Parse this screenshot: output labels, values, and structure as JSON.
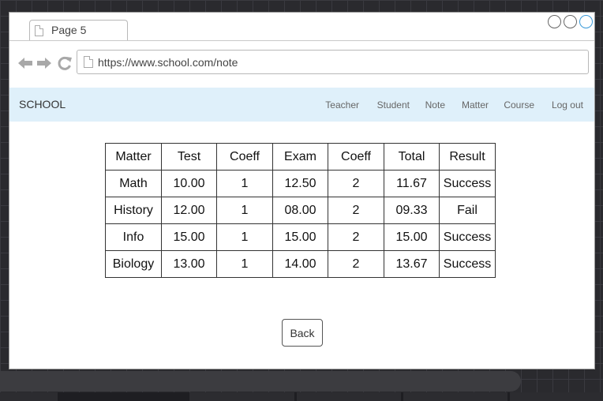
{
  "browser": {
    "tab_title": "Page 5",
    "url": "https://www.school.com/note"
  },
  "navbar": {
    "brand": "SCHOOL",
    "links": [
      "Teacher",
      "Student",
      "Note",
      "Matter",
      "Course",
      "Log out"
    ]
  },
  "table": {
    "headers": [
      "Matter",
      "Test",
      "Coeff",
      "Exam",
      "Coeff",
      "Total",
      "Result"
    ],
    "rows": [
      [
        "Math",
        "10.00",
        "1",
        "12.50",
        "2",
        "11.67",
        "Success"
      ],
      [
        "History",
        "12.00",
        "1",
        "08.00",
        "2",
        "09.33",
        "Fail"
      ],
      [
        "Info",
        "15.00",
        "1",
        "15.00",
        "2",
        "15.00",
        "Success"
      ],
      [
        "Biology",
        "13.00",
        "1",
        "14.00",
        "2",
        "13.67",
        "Success"
      ]
    ]
  },
  "actions": {
    "back_label": "Back"
  },
  "colors": {
    "navbar_bg": "#dff0fa",
    "accent": "#3a9ad9"
  }
}
